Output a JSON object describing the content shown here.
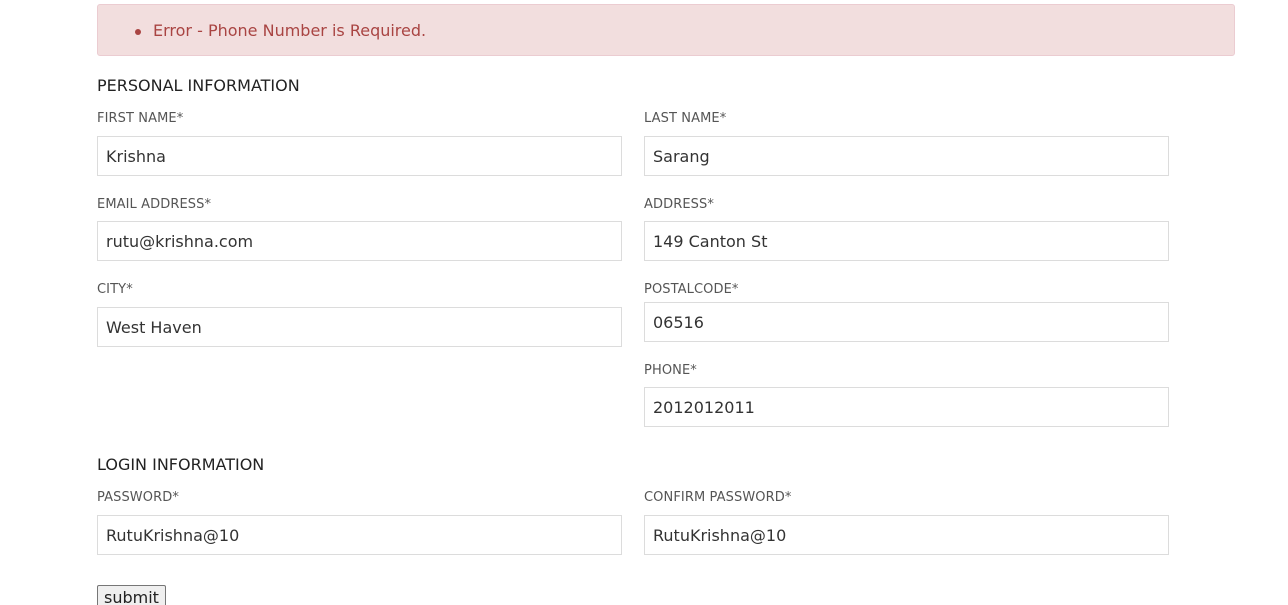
{
  "error": {
    "items": [
      "Error - Phone Number is Required."
    ]
  },
  "personal": {
    "title": "PERSONAL INFORMATION",
    "first_name": {
      "label": "FIRST NAME*",
      "value": "Krishna"
    },
    "last_name": {
      "label": "LAST NAME*",
      "value": "Sarang"
    },
    "email": {
      "label": "EMAIL ADDRESS*",
      "value": "rutu@krishna.com"
    },
    "address": {
      "label": "ADDRESS*",
      "value": "149 Canton St"
    },
    "city": {
      "label": "CITY*",
      "value": "West Haven"
    },
    "postalcode": {
      "label": "POSTALCODE*",
      "value": "06516"
    },
    "phone": {
      "label": "PHONE*",
      "value": "2012012011"
    }
  },
  "login": {
    "title": "LOGIN INFORMATION",
    "password": {
      "label": "PASSWORD*",
      "value": "RutuKrishna@10"
    },
    "confirm_password": {
      "label": "CONFIRM PASSWORD*",
      "value": "RutuKrishna@10"
    }
  },
  "form": {
    "submit_label": "submit"
  },
  "colors": {
    "alert_bg": "#f2dede",
    "alert_border": "#ebccd1",
    "alert_text": "#a94442"
  }
}
